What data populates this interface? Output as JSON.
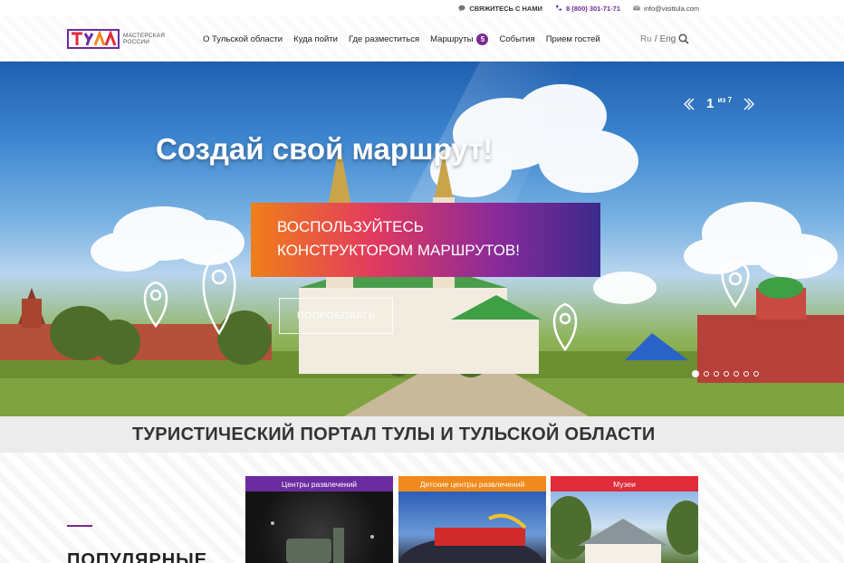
{
  "topbar": {
    "contact_label": "СВЯЖИТЕСЬ С НАМИ",
    "phone": "8 (800) 301-71-71",
    "email": "info@visittula.com"
  },
  "header": {
    "logo_text": "МАСТЕРСКАЯ РОССИИ",
    "nav": [
      {
        "label": "О Тульской области"
      },
      {
        "label": "Куда пойти"
      },
      {
        "label": "Где разместиться"
      },
      {
        "label": "Маршруты",
        "badge": "5"
      },
      {
        "label": "События"
      },
      {
        "label": "Прием гостей"
      }
    ],
    "lang_ru": "Ru",
    "lang_sep": "/",
    "lang_en": "Eng"
  },
  "hero": {
    "title": "Создай свой маршрут!",
    "promo_line1": "ВОСПОЛЬЗУЙТЕСЬ",
    "promo_line2": "КОНСТРУКТОРОМ МАРШРУТОВ!",
    "try_button": "ПОПРОБОВАТЬ",
    "slide_current": "1",
    "slide_of": "из 7",
    "slide_total": 7,
    "active_dot": 1
  },
  "section": {
    "title": "ТУРИСТИЧЕСКИЙ ПОРТАЛ ТУЛЫ И ТУЛЬСКОЙ ОБЛАСТИ",
    "popular_heading": "ПОПУЛЯРНЫЕ"
  },
  "categories": [
    {
      "label": "Центры развлечений",
      "color": "#6a2ca0"
    },
    {
      "label": "Детские центры развлечений",
      "color": "#f08a1c"
    },
    {
      "label": "Музеи",
      "color": "#e02b3a"
    }
  ],
  "colors": {
    "brand_purple": "#7a2a91",
    "phone_color": "#6a2c91"
  }
}
